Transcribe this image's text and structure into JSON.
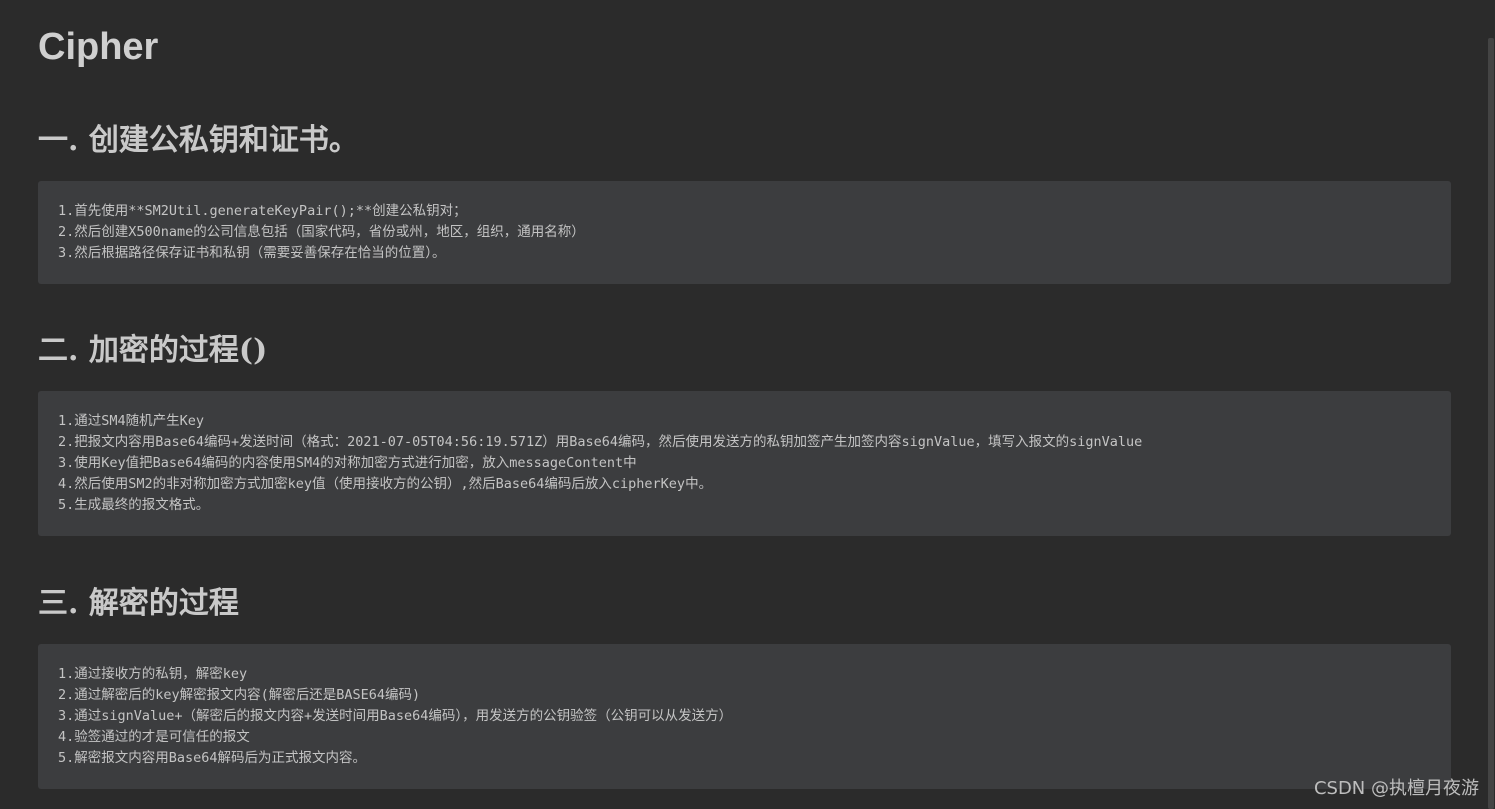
{
  "document": {
    "title": "Cipher"
  },
  "sections": [
    {
      "heading": "一. 创建公私钥和证书。",
      "lines": [
        "1.首先使用**SM2Util.generateKeyPair();**创建公私钥对；",
        "2.然后创建X500name的公司信息包括（国家代码，省份或州，地区，组织，通用名称）",
        "3.然后根据路径保存证书和私钥（需要妥善保存在恰当的位置）。"
      ]
    },
    {
      "heading": "二. 加密的过程()",
      "lines": [
        "1.通过SM4随机产生Key",
        "2.把报文内容用Base64编码+发送时间（格式：2021-07-05T04:56:19.571Z）用Base64编码，然后使用发送方的私钥加签产生加签内容signValue，填写入报文的signValue",
        "3.使用Key值把Base64编码的内容使用SM4的对称加密方式进行加密，放入messageContent中",
        "4.然后使用SM2的非对称加密方式加密key值（使用接收方的公钥）,然后Base64编码后放入cipherKey中。",
        "5.生成最终的报文格式。"
      ]
    },
    {
      "heading": "三. 解密的过程",
      "lines": [
        "1.通过接收方的私钥，解密key",
        "2.通过解密后的key解密报文内容(解密后还是BASE64编码)",
        "3.通过signValue+（解密后的报文内容+发送时间用Base64编码），用发送方的公钥验签（公钥可以从发送方）",
        "4.验签通过的才是可信任的报文",
        "5.解密报文内容用Base64解码后为正式报文内容。"
      ]
    }
  ],
  "watermark": "CSDN @执檀月夜游"
}
